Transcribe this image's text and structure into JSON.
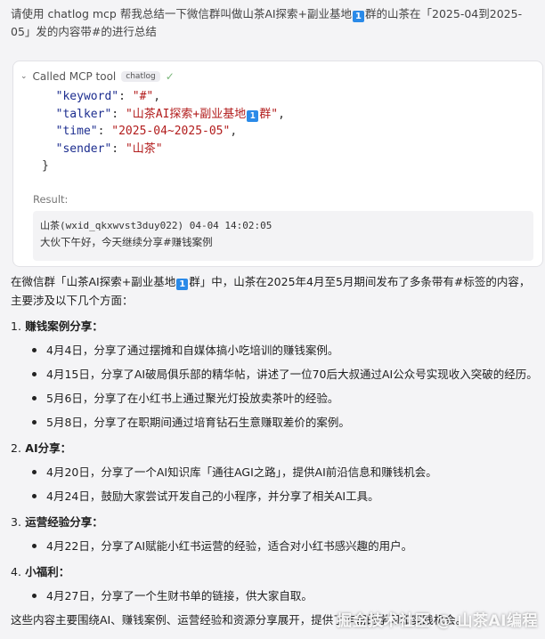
{
  "user_message": {
    "part1": "请使用 chatlog mcp 帮我总结一下微信群叫做山茶AI探索+副业基地",
    "badge": "1",
    "part2": "群的山茶在「2025-04到2025-05」发的内容带#的进行总结"
  },
  "tool_call": {
    "label": "Called MCP tool",
    "tool_name": "chatlog",
    "params": [
      {
        "key": "\"keyword\"",
        "value": "\"#\""
      },
      {
        "key": "\"talker\"",
        "value": "\"山茶AI探索+副业基地",
        "badge": "1",
        "value_tail": "群\""
      },
      {
        "key": "\"time\"",
        "value": "\"2025-04~2025-05\""
      },
      {
        "key": "\"sender\"",
        "value": "\"山茶\""
      }
    ],
    "result_label": "Result:",
    "result_line1": "山茶(wxid_qkxwvst3duy022) 04-04 14:02:05",
    "result_line2": "大伙下午好，今天继续分享#赚钱案例"
  },
  "answer": {
    "intro_part1": "在微信群「山茶AI探索+副业基地",
    "intro_badge": "1",
    "intro_part2": "群」中，山茶在2025年4月至5月期间发布了多条带有#标签的内容，主要涉及以下几个方面：",
    "sections": [
      {
        "num": "1.",
        "title": "赚钱案例分享：",
        "items": [
          "4月4日，分享了通过摆摊和自媒体搞小吃培训的赚钱案例。",
          "4月15日，分享了AI破局俱乐部的精华帖，讲述了一位70后大叔通过AI公众号实现收入突破的经历。",
          "5月6日，分享了在小红书上通过聚光灯投放卖茶叶的经验。",
          "5月8日，分享了在职期间通过培育钻石生意赚取差价的案例。"
        ]
      },
      {
        "num": "2.",
        "title": "AI分享：",
        "items": [
          "4月20日，分享了一个AI知识库「通往AGI之路」，提供AI前沿信息和赚钱机会。",
          "4月24日，鼓励大家尝试开发自己的小程序，并分享了相关AI工具。"
        ]
      },
      {
        "num": "3.",
        "title": "运营经验分享：",
        "items": [
          "4月22日，分享了AI赋能小红书运营的经验，适合对小红书感兴趣的用户。"
        ]
      },
      {
        "num": "4.",
        "title": "小福利：",
        "items": [
          "4月27日，分享了一个生财书单的链接，供大家自取。"
        ]
      }
    ],
    "closing": "这些内容主要围绕AI、赚钱案例、运营经验和资源分享展开，提供了丰富的学习和实践机会。"
  },
  "watermark": "掘金技术社区 @ 山茶AI编程"
}
